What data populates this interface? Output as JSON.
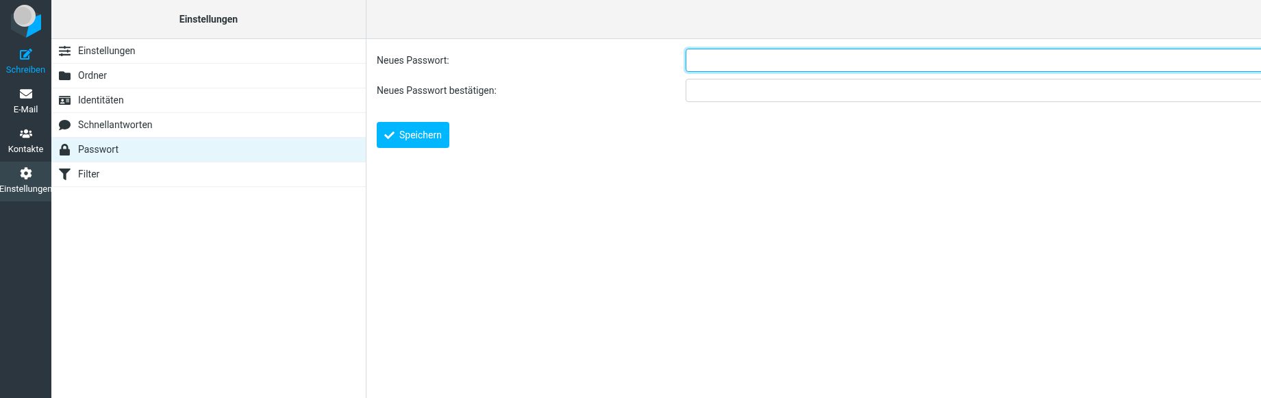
{
  "nav": [
    {
      "label": "Schreiben",
      "highlighted": true,
      "selected": false
    },
    {
      "label": "E-Mail",
      "highlighted": false,
      "selected": false
    },
    {
      "label": "Kontakte",
      "highlighted": false,
      "selected": false
    },
    {
      "label": "Einstellungen",
      "highlighted": false,
      "selected": true
    }
  ],
  "sections": {
    "title": "Einstellungen",
    "items": [
      {
        "label": "Einstellungen",
        "selected": false
      },
      {
        "label": "Ordner",
        "selected": false
      },
      {
        "label": "Identitäten",
        "selected": false
      },
      {
        "label": "Schnellantworten",
        "selected": false
      },
      {
        "label": "Passwort",
        "selected": true
      },
      {
        "label": "Filter",
        "selected": false
      }
    ]
  },
  "form": {
    "fields": [
      {
        "label": "Neues Passwort:",
        "focused": true
      },
      {
        "label": "Neues Passwort bestätigen:",
        "focused": false
      }
    ],
    "save_button": "Speichern"
  }
}
